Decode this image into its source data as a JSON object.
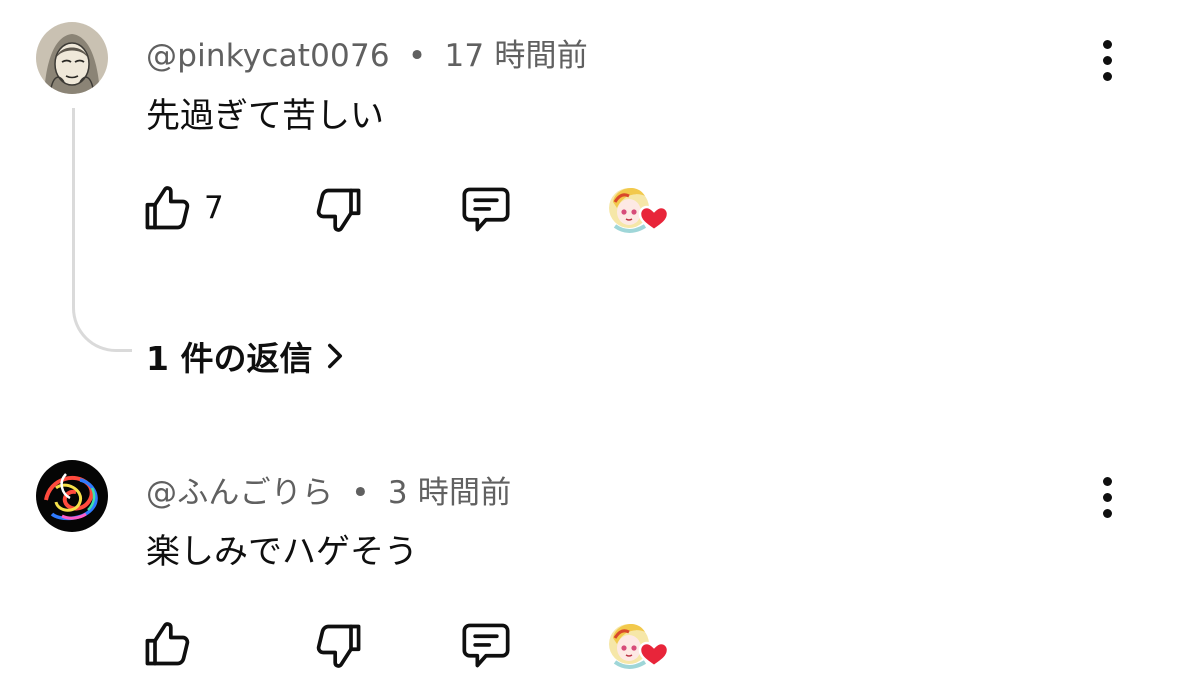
{
  "comments": [
    {
      "author": "@pinkycat0076",
      "separator": "•",
      "time": "17 時間前",
      "text": "先過ぎて苦しい",
      "like_count": "7",
      "icons": {
        "avatar": "sketch-face-avatar",
        "like": "thumbs-up-icon",
        "dislike": "thumbs-down-icon",
        "reply": "reply-comment-icon",
        "creator_heart": "creator-heart-badge",
        "more": "more-vertical-icon"
      },
      "replies_label": "1 件の返信",
      "replies_icon": "chevron-right-icon"
    },
    {
      "author": "@ふんごりら",
      "separator": "•",
      "time": "3 時間前",
      "text": "楽しみでハゲそう",
      "like_count": "",
      "icons": {
        "avatar": "neon-swirl-avatar",
        "like": "thumbs-up-icon",
        "dislike": "thumbs-down-icon",
        "reply": "reply-comment-icon",
        "creator_heart": "creator-heart-badge",
        "more": "more-vertical-icon"
      }
    }
  ],
  "colors": {
    "text_primary": "#0f0f0f",
    "text_secondary": "#606060",
    "heart": "#e8253a",
    "thread_line": "#dadada"
  }
}
